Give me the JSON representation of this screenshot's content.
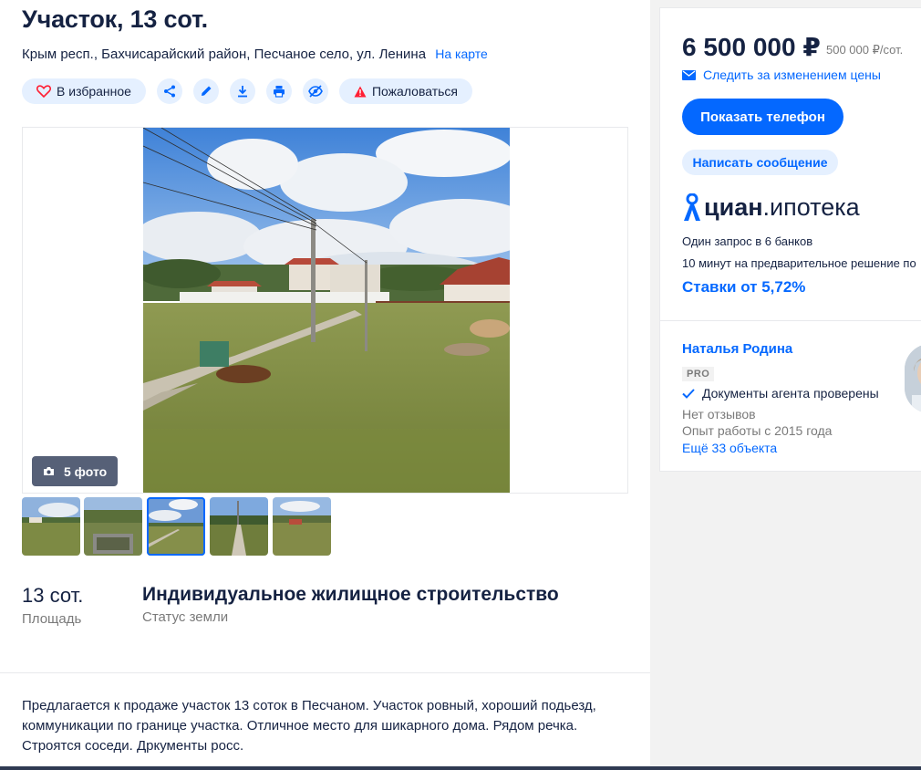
{
  "listing": {
    "title": "Участок, 13 сот.",
    "address": "Крым респ., Бахчисарайский район, Песчаное село, ул. Ленина",
    "map_link": "На карте"
  },
  "actions": {
    "favorite_label": "В избранное",
    "report_label": "Пожаловаться"
  },
  "gallery": {
    "photo_count_label": "5 фото",
    "selected_index": 2
  },
  "facts": [
    {
      "value": "13 сот.",
      "label": "Площадь"
    },
    {
      "value": "Индивидуальное жилищное строительство",
      "label": "Статус земли"
    }
  ],
  "description": "Предлагается к продаже участок 13 соток в Песчаном. Участок ровный, хороший подьезд, коммуникации по границе участка.  Отличное место для шикарного дома. Рядом речка. Строятся соседи. Дркументы росс.",
  "sidebar": {
    "price": "6 500 000 ₽",
    "price_per_unit": "500 000 ₽/сот.",
    "follow_price": "Следить за изменением цены",
    "show_phone": "Показать телефон",
    "write_message": "Написать сообщение"
  },
  "mortgage": {
    "logo_bold": "циан",
    "logo_text": ".ипотека",
    "line1": "Один запрос в 6 банков",
    "line2": "10 минут на предварительное решение по",
    "rate": "Ставки от 5,72%"
  },
  "agent": {
    "name": "Наталья Родина",
    "badge": "PRO",
    "verified": "Документы агента проверены",
    "reviews": "Нет отзывов",
    "experience": "Опыт работы с 2015 года",
    "more_objects": "Ещё 33 объекта"
  },
  "colors": {
    "accent": "#0468ff",
    "text": "#152242",
    "muted": "#7a7a7a",
    "pill_bg": "#e5f0ff",
    "danger": "#ff1f34"
  }
}
